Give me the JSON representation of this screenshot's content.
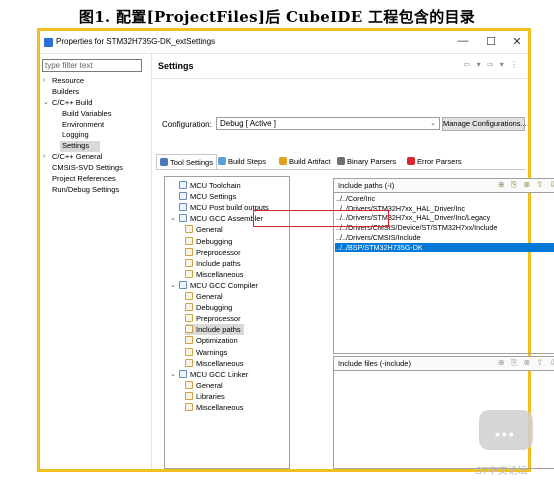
{
  "caption": "图1. 配置[ProjectFiles]后 CubeIDE 工程包含的目录",
  "window": {
    "title": "Properties for STM32H735G-DK_extSettings",
    "minimize": "—",
    "maximize": "☐",
    "close": "✕"
  },
  "filter": {
    "placeholder": "type filter text"
  },
  "nav_tree": [
    {
      "label": "Resource",
      "indent": 1,
      "arrow": "›"
    },
    {
      "label": "Builders",
      "indent": 1,
      "arrow": ""
    },
    {
      "label": "C/C++ Build",
      "indent": 1,
      "arrow": "⌄"
    },
    {
      "label": "Build Variables",
      "indent": 2,
      "arrow": ""
    },
    {
      "label": "Environment",
      "indent": 2,
      "arrow": ""
    },
    {
      "label": "Logging",
      "indent": 2,
      "arrow": ""
    },
    {
      "label": "Settings",
      "indent": 2,
      "arrow": "",
      "selected": true
    },
    {
      "label": "C/C++ General",
      "indent": 1,
      "arrow": "›"
    },
    {
      "label": "CMSIS-SVD Settings",
      "indent": 1,
      "arrow": ""
    },
    {
      "label": "Project References",
      "indent": 1,
      "arrow": ""
    },
    {
      "label": "Run/Debug Settings",
      "indent": 1,
      "arrow": ""
    }
  ],
  "header": {
    "title": "Settings",
    "nav_icons": "⇦ ▾ ⇨ ▾ ⋮"
  },
  "configuration": {
    "label": "Configuration:",
    "value": "Debug  [ Active ]",
    "manage_button": "Manage Configurations..."
  },
  "tabs": [
    {
      "label": "Tool Settings",
      "active": true,
      "color": "#4a78b8"
    },
    {
      "label": "Build Steps",
      "active": false,
      "color": "#5aa0d8"
    },
    {
      "label": "Build Artifact",
      "active": false,
      "color": "#e0a020"
    },
    {
      "label": "Binary Parsers",
      "active": false,
      "color": "#6f6f6f"
    },
    {
      "label": "Error Parsers",
      "active": false,
      "color": "#d9262e"
    }
  ],
  "tool_tree": [
    {
      "label": "MCU Toolchain",
      "level": 0,
      "expand": ""
    },
    {
      "label": "MCU Settings",
      "level": 0,
      "expand": ""
    },
    {
      "label": "MCU Post build outputs",
      "level": 0,
      "expand": ""
    },
    {
      "label": "MCU GCC Assembler",
      "level": 0,
      "expand": "⌄"
    },
    {
      "label": "General",
      "level": 1,
      "expand": ""
    },
    {
      "label": "Debugging",
      "level": 1,
      "expand": ""
    },
    {
      "label": "Preprocessor",
      "level": 1,
      "expand": ""
    },
    {
      "label": "Include paths",
      "level": 1,
      "expand": ""
    },
    {
      "label": "Miscellaneous",
      "level": 1,
      "expand": ""
    },
    {
      "label": "MCU GCC Compiler",
      "level": 0,
      "expand": "⌄"
    },
    {
      "label": "General",
      "level": 1,
      "expand": ""
    },
    {
      "label": "Debugging",
      "level": 1,
      "expand": ""
    },
    {
      "label": "Preprocessor",
      "level": 1,
      "expand": ""
    },
    {
      "label": "Include paths",
      "level": 1,
      "expand": "",
      "selected": true
    },
    {
      "label": "Optimization",
      "level": 1,
      "expand": ""
    },
    {
      "label": "Warnings",
      "level": 1,
      "expand": ""
    },
    {
      "label": "Miscellaneous",
      "level": 1,
      "expand": ""
    },
    {
      "label": "MCU GCC Linker",
      "level": 0,
      "expand": "⌄"
    },
    {
      "label": "General",
      "level": 1,
      "expand": ""
    },
    {
      "label": "Libraries",
      "level": 1,
      "expand": ""
    },
    {
      "label": "Miscellaneous",
      "level": 1,
      "expand": ""
    }
  ],
  "include_paths": {
    "title": "Include paths (-I)",
    "icons": "⊕ ⎘ ⊗ ⇧ ⇩",
    "items": [
      {
        "path": "../../Core/Inc",
        "highlight": false
      },
      {
        "path": "../../Drivers/STM32H7xx_HAL_Driver/Inc",
        "highlight": false
      },
      {
        "path": "../../Drivers/STM32H7xx_HAL_Driver/Inc/Legacy",
        "highlight": false
      },
      {
        "path": "../../Drivers/CMSIS/Device/ST/STM32H7xx/Include",
        "highlight": false
      },
      {
        "path": "../../Drivers/CMSIS/Include",
        "highlight": false
      },
      {
        "path": "../../BSP/STM32H735G-DK",
        "highlight": true
      }
    ]
  },
  "include_files": {
    "title": "Include files (-include)",
    "icons": "⊕ ⎘ ⊗ ⇧ ⇩"
  },
  "watermark": {
    "text": "ST中文论坛",
    "dots": "•••"
  }
}
